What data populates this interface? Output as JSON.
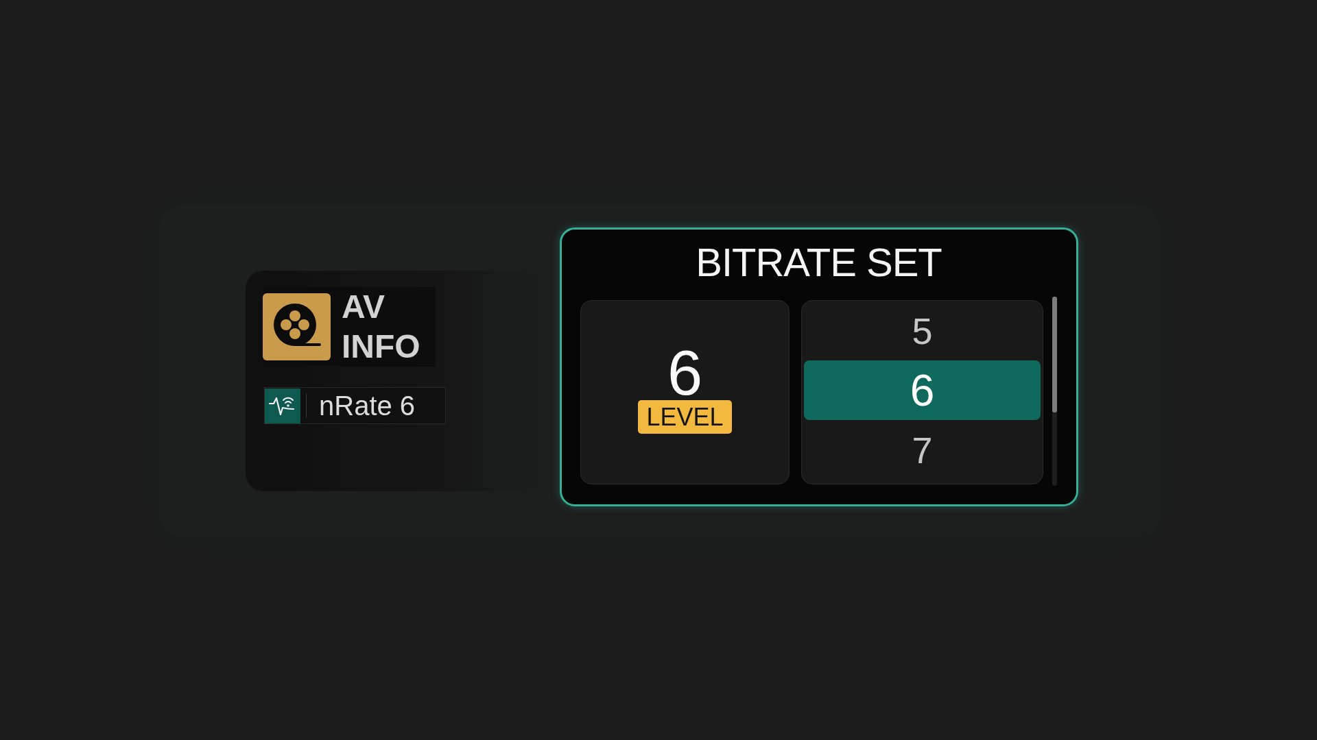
{
  "info_panel": {
    "title": "AV INFO",
    "status": {
      "label": "nRate 6"
    }
  },
  "dialog": {
    "title": "BITRATE SET",
    "current": {
      "value": "6",
      "tag": "LEVEL"
    },
    "options": [
      {
        "label": "5",
        "selected": false
      },
      {
        "label": "6",
        "selected": true
      },
      {
        "label": "7",
        "selected": false
      }
    ]
  }
}
